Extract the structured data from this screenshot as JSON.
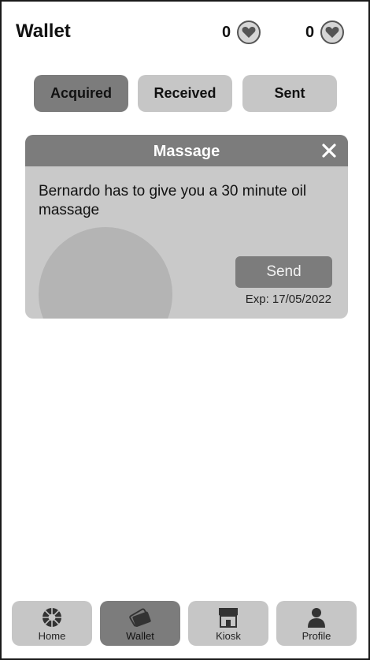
{
  "header": {
    "title": "Wallet",
    "counters": [
      {
        "value": "0",
        "icon": "heart-coin-icon"
      },
      {
        "value": "0",
        "icon": "heart-coin-icon"
      }
    ]
  },
  "tabs": [
    {
      "label": "Acquired",
      "active": true
    },
    {
      "label": "Received",
      "active": false
    },
    {
      "label": "Sent",
      "active": false
    }
  ],
  "card": {
    "title": "Massage",
    "description": "Bernardo has to give you a 30 minute oil massage",
    "send_label": "Send",
    "expiry": "Exp: 17/05/2022"
  },
  "nav": [
    {
      "label": "Home",
      "icon": "home-wheel-icon",
      "active": false
    },
    {
      "label": "Wallet",
      "icon": "wallet-cards-icon",
      "active": true
    },
    {
      "label": "Kiosk",
      "icon": "kiosk-shop-icon",
      "active": false
    },
    {
      "label": "Profile",
      "icon": "profile-person-icon",
      "active": false
    }
  ],
  "colors": {
    "active": "#7c7c7c",
    "inactive": "#c6c6c6",
    "card": "#c9c9c9",
    "card_shape": "#b4b4b4"
  }
}
